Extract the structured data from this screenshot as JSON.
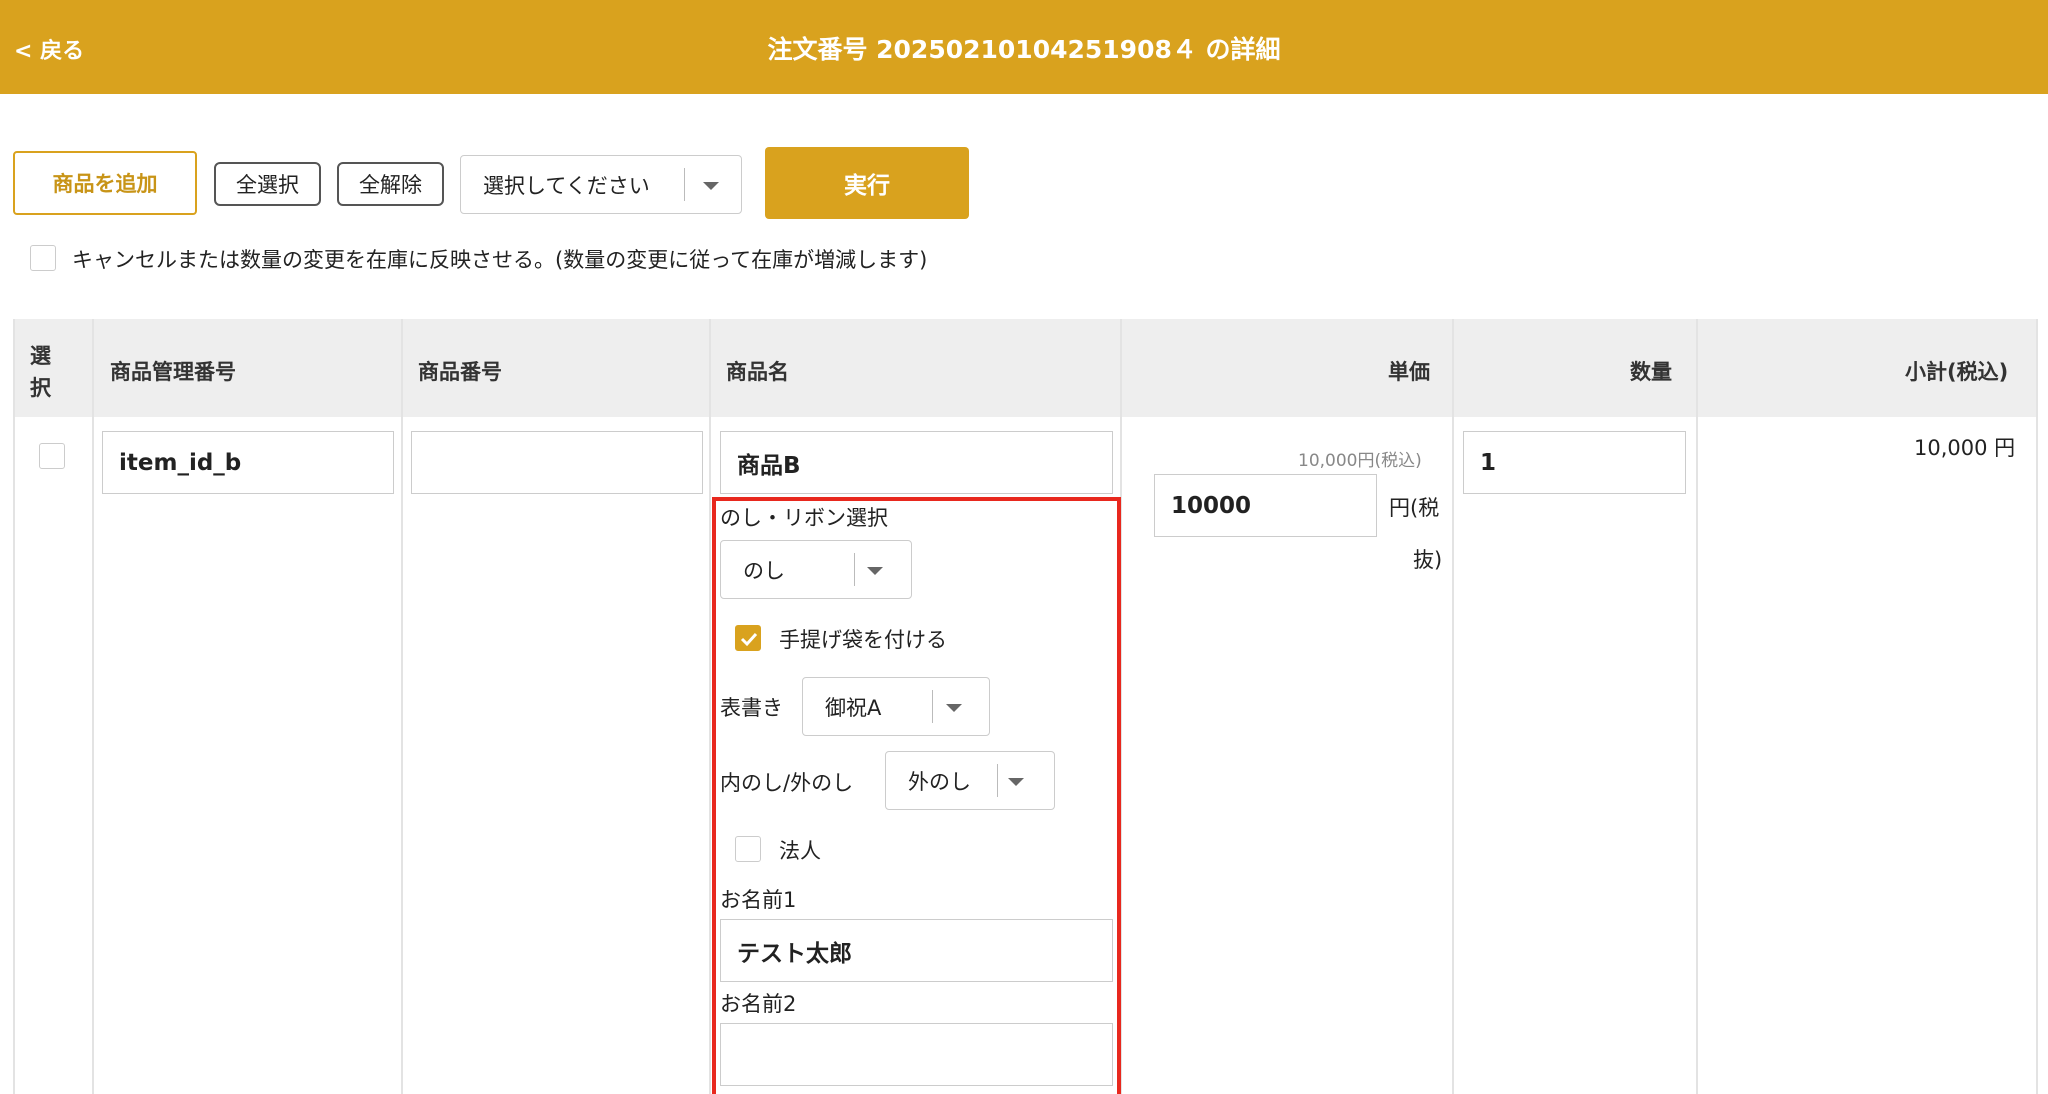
{
  "header": {
    "back_label": "< 戻る",
    "title": "注文番号 20250210104251908４ の詳細"
  },
  "toolbar": {
    "add_product": "商品を追加",
    "select_all": "全選択",
    "deselect_all": "全解除",
    "action_select": "選択してください",
    "execute": "実行"
  },
  "stock_option": {
    "label": "キャンセルまたは数量の変更を在庫に反映させる。(数量の変更に従って在庫が増減します)",
    "checked": false
  },
  "table": {
    "headers": {
      "select_line1": "選",
      "select_line2": "択",
      "item_code": "商品管理番号",
      "product_number": "商品番号",
      "product_name": "商品名",
      "unit_price": "単価",
      "quantity": "数量",
      "subtotal": "小計(税込)"
    },
    "row": {
      "item_code": "item_id_b",
      "product_number": "",
      "product_name": "商品B",
      "price_with_tax": "10,000円(税込)",
      "price_input": "10000",
      "price_unit_line1": "円(税",
      "price_unit_line2": "抜)",
      "quantity": "1",
      "subtotal": "10,000 円"
    }
  },
  "noshi": {
    "section_label": "のし・リボン選択",
    "type_value": "のし",
    "bag_label": "手提げ袋を付ける",
    "bag_checked": true,
    "omote_label": "表書き",
    "omote_value": "御祝A",
    "uchi_soto_label": "内のし/外のし",
    "uchi_soto_value": "外のし",
    "corporate_label": "法人",
    "corporate_checked": false,
    "name1_label": "お名前1",
    "name1_value": "テスト太郎",
    "name2_label": "お名前2",
    "name2_value": ""
  },
  "colors": {
    "accent": "#d9a21e",
    "highlight_border": "#e8281e"
  }
}
